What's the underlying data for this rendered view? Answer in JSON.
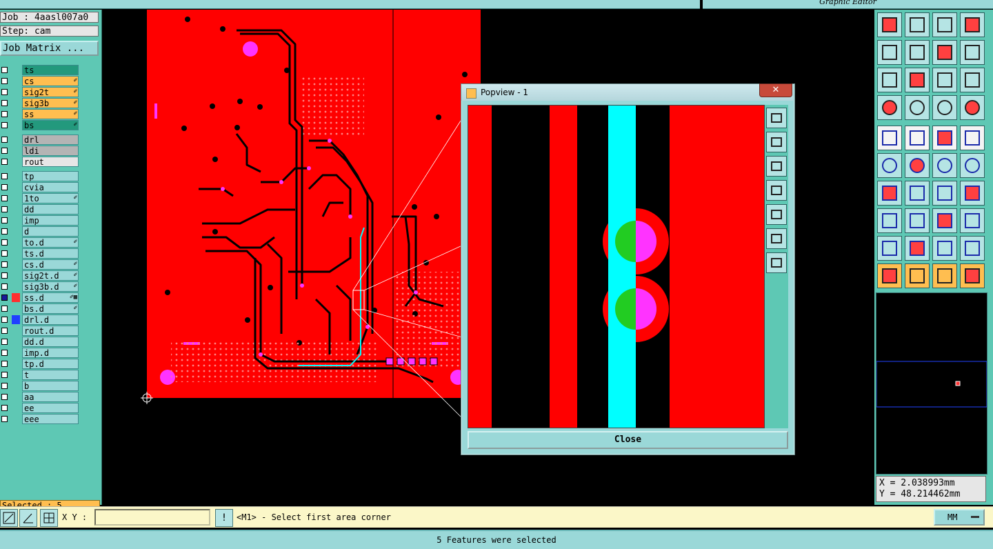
{
  "titlebar": {
    "right_title": "Graphic Editor"
  },
  "job": {
    "job_label": "Job : 4aasl007a0",
    "step_label": "Step: cam",
    "matrix_button": "Job Matrix ..."
  },
  "layers": [
    {
      "name": "ts",
      "kind": "board",
      "mark": ""
    },
    {
      "name": "cs",
      "kind": "sig",
      "mark": "✐"
    },
    {
      "name": "sig2t",
      "kind": "sig",
      "mark": "✐"
    },
    {
      "name": "sig3b",
      "kind": "sig",
      "mark": "✐"
    },
    {
      "name": "ss",
      "kind": "sig",
      "mark": "✐"
    },
    {
      "name": "bs",
      "kind": "board",
      "mark": "✐"
    },
    {
      "name": "drl",
      "kind": "drill",
      "mark": ""
    },
    {
      "name": "ldi",
      "kind": "drill",
      "mark": ""
    },
    {
      "name": "rout",
      "kind": "rout",
      "mark": ""
    },
    {
      "name": "tp",
      "kind": "misc",
      "mark": ""
    },
    {
      "name": "cvia",
      "kind": "misc",
      "mark": ""
    },
    {
      "name": "1to",
      "kind": "misc",
      "mark": "✐"
    },
    {
      "name": "dd",
      "kind": "misc",
      "mark": ""
    },
    {
      "name": "imp",
      "kind": "misc",
      "mark": ""
    },
    {
      "name": "d",
      "kind": "misc",
      "mark": ""
    },
    {
      "name": "to.d",
      "kind": "misc",
      "mark": "✐"
    },
    {
      "name": "ts.d",
      "kind": "misc",
      "mark": ""
    },
    {
      "name": "cs.d",
      "kind": "misc",
      "mark": "✐"
    },
    {
      "name": "sig2t.d",
      "kind": "misc",
      "mark": "✐"
    },
    {
      "name": "sig3b.d",
      "kind": "misc",
      "mark": "✐"
    },
    {
      "name": "ss.d",
      "kind": "misc",
      "mark": "✐▦",
      "work": true
    },
    {
      "name": "bs.d",
      "kind": "misc",
      "mark": "✐"
    },
    {
      "name": "drl.d",
      "kind": "misc",
      "mark": "",
      "affected": true
    },
    {
      "name": "rout.d",
      "kind": "misc",
      "mark": ""
    },
    {
      "name": "dd.d",
      "kind": "misc",
      "mark": ""
    },
    {
      "name": "imp.d",
      "kind": "misc",
      "mark": ""
    },
    {
      "name": "tp.d",
      "kind": "misc",
      "mark": ""
    },
    {
      "name": "t",
      "kind": "misc",
      "mark": ""
    },
    {
      "name": "b",
      "kind": "misc",
      "mark": ""
    },
    {
      "name": "aa",
      "kind": "misc",
      "mark": ""
    },
    {
      "name": "ee",
      "kind": "misc",
      "mark": ""
    },
    {
      "name": "eee",
      "kind": "misc",
      "mark": ""
    }
  ],
  "selection": {
    "label": "Selected : 5"
  },
  "command": {
    "xy_label": "X Y :",
    "xy_value": "",
    "alert_icon": "!",
    "prompt": "<M1> - Select first area corner",
    "units": "MM"
  },
  "status": {
    "message": "5 Features were selected"
  },
  "coords": {
    "x": "X = 2.038993mm",
    "y": "Y = 48.214462mm"
  },
  "popview": {
    "title": "Popview - 1",
    "close_icon": "✕",
    "close_button": "Close"
  },
  "colors": {
    "board": "#ff0000",
    "trace": "#000000",
    "pad": "#ff33ff",
    "highlight": "#00ffff",
    "drill": "#22cc22",
    "panel": "#5ec8b4"
  }
}
